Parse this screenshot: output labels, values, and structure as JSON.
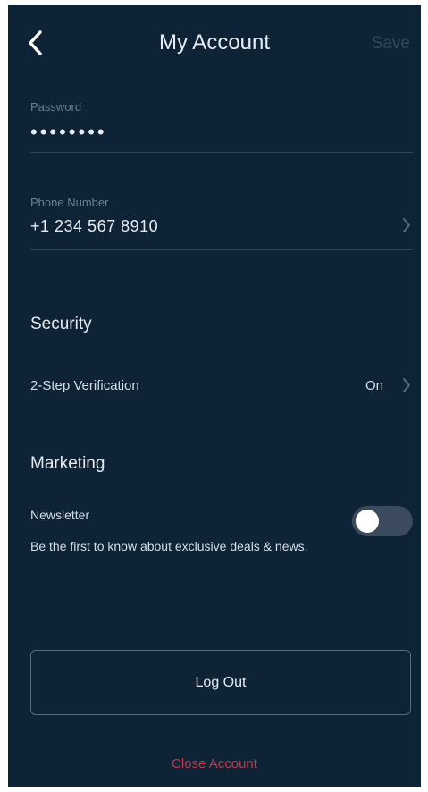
{
  "header": {
    "title": "My Account",
    "save_label": "Save",
    "back_icon": "chevron-left-icon"
  },
  "account": {
    "password_label": "Password",
    "password_value": "••••••••",
    "phone_label": "Phone Number",
    "phone_value": "+1 234 567 8910"
  },
  "security": {
    "title": "Security",
    "two_step_label": "2-Step Verification",
    "two_step_value": "On"
  },
  "marketing": {
    "title": "Marketing",
    "newsletter_label": "Newsletter",
    "newsletter_description": "Be the first to know about exclusive deals & news.",
    "newsletter_enabled": false
  },
  "actions": {
    "logout_label": "Log Out",
    "close_account_label": "Close Account"
  },
  "colors": {
    "background": "#0f2337",
    "danger": "#c2384a",
    "muted": "#33475c"
  }
}
